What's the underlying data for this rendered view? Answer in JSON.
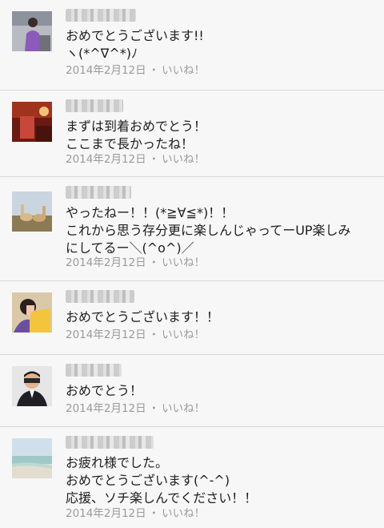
{
  "comments": [
    {
      "avatar": "woman-purple-icon",
      "lines": [
        "おめでとうございます!!",
        "ヽ(*^∇^*)ﾉ"
      ],
      "date": "2014年2月12日",
      "sep": "・",
      "like": "いいね！"
    },
    {
      "avatar": "red-room-icon",
      "lines": [
        "まずは到着おめでとう！",
        "ここまで長かったね！"
      ],
      "date": "2014年2月12日",
      "sep": "・",
      "like": "いいね！"
    },
    {
      "avatar": "alpacas-icon",
      "lines": [
        "やったねー！！(*≧∀≦*)！！",
        "これから思う存分更に楽しんじゃってーUP楽しみ",
        "にしてるー＼(^o^)／"
      ],
      "date": "2014年2月12日",
      "sep": "・",
      "like": "いいね！"
    },
    {
      "avatar": "woman-yellow-icon",
      "lines": [
        "おめでとうございます！！"
      ],
      "date": "2014年2月12日",
      "sep": "・",
      "like": "いいね！"
    },
    {
      "avatar": "man-suit-icon",
      "lines": [
        "おめでとう！"
      ],
      "date": "2014年2月12日",
      "sep": "・",
      "like": "いいね！"
    },
    {
      "avatar": "beach-icon",
      "lines": [
        "お疲れ様でした。",
        "おめでとうございます(^-^)",
        "応援、ソチ楽しんでください！！"
      ],
      "date": "2014年2月12日",
      "sep": "・",
      "like": "いいね！"
    }
  ]
}
